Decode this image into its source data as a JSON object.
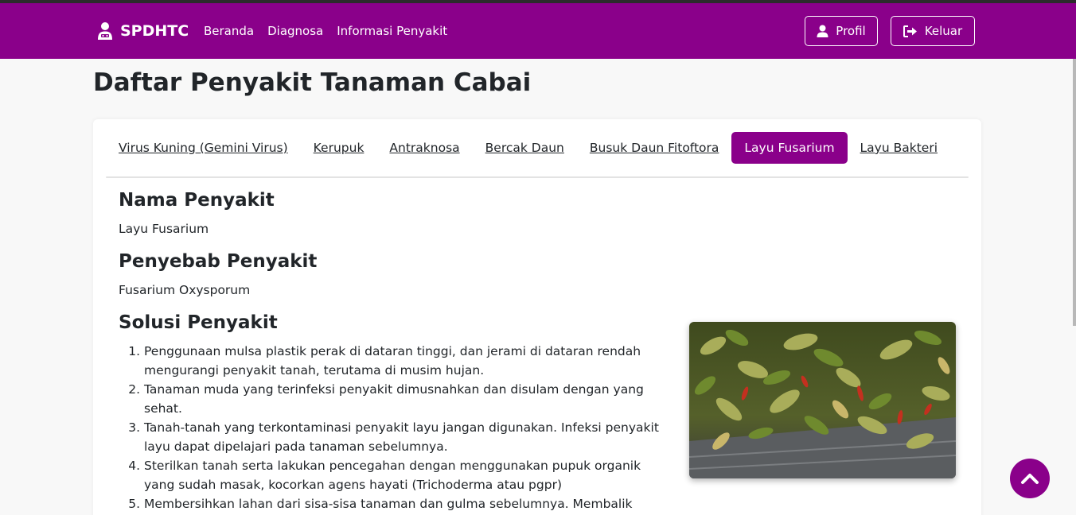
{
  "navbar": {
    "brand": "SPDHTC",
    "links": [
      "Beranda",
      "Diagnosa",
      "Informasi Penyakit"
    ],
    "profile_label": "Profil",
    "logout_label": "Keluar",
    "background_color": "#8a008a"
  },
  "page": {
    "title": "Daftar Penyakit Tanaman Cabai"
  },
  "tabs": [
    {
      "label": "Virus Kuning (Gemini Virus)",
      "active": false
    },
    {
      "label": "Kerupuk",
      "active": false
    },
    {
      "label": "Antraknosa",
      "active": false
    },
    {
      "label": "Bercak Daun",
      "active": false
    },
    {
      "label": "Busuk Daun Fitoftora",
      "active": false
    },
    {
      "label": "Layu Fusarium",
      "active": true
    },
    {
      "label": "Layu Bakteri",
      "active": false
    }
  ],
  "disease": {
    "name_heading": "Nama Penyakit",
    "name": "Layu Fusarium",
    "cause_heading": "Penyebab Penyakit",
    "cause": "Fusarium Oxysporum",
    "solution_heading": "Solusi Penyakit",
    "solutions": [
      "Penggunaan mulsa plastik perak di dataran tinggi, dan jerami di dataran rendah mengurangi penyakit tanah, terutama di musim hujan.",
      "Tanaman muda yang terinfeksi penyakit dimusnahkan dan disulam dengan yang sehat.",
      "Tanah-tanah yang terkontaminasi penyakit layu jangan digunakan. Infeksi penyakit layu dapat dipelajari pada tanaman sebelumnya.",
      "Sterilkan tanah serta lakukan pencegahan dengan menggunakan pupuk organik yang sudah masak, kocorkan agens hayati (Trichoderma atau pgpr)",
      "Membersihkan lahan dari sisa-sisa tanaman dan gulma sebelumnya. Membalik"
    ]
  },
  "icons": {
    "brand": "user-doctor-icon",
    "profile": "user-icon",
    "logout": "sign-out-icon",
    "scroll_top": "chevron-up-icon"
  }
}
